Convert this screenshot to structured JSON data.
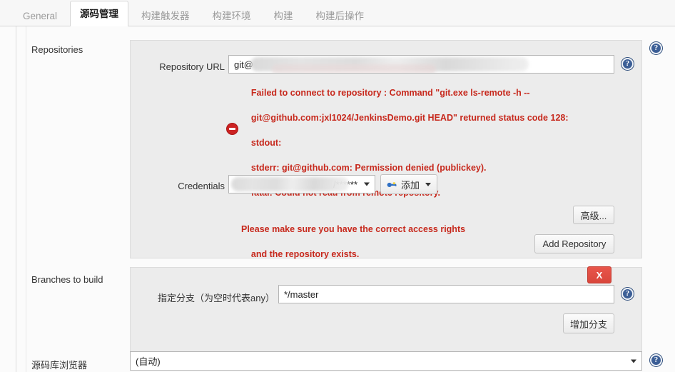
{
  "tabs": [
    {
      "label": "General",
      "active": false
    },
    {
      "label": "源码管理",
      "active": true
    },
    {
      "label": "构建触发器",
      "active": false
    },
    {
      "label": "构建环境",
      "active": false
    },
    {
      "label": "构建",
      "active": false
    },
    {
      "label": "构建后操作",
      "active": false
    }
  ],
  "sections": {
    "repositories": {
      "label": "Repositories",
      "repository_url": {
        "label": "Repository URL",
        "value": "git@",
        "redacted": true
      },
      "error": {
        "icon": "error-stop-icon",
        "line1": "Failed to connect to repository : Command \"git.exe ls-remote -h --",
        "line2": "git@github.com:jxl1024/JenkinsDemo.git HEAD\" returned status code 128:",
        "line3": "stdout:",
        "line4": "stderr: git@github.com: Permission denied (publickey).",
        "line5": "fatal: Could not read from remote repository.",
        "line6": "Please make sure you have the correct access rights",
        "line7": "and the repository exists."
      },
      "credentials": {
        "label": "Credentials",
        "value": "/******",
        "redacted": true,
        "add_button": "添加",
        "add_button_icon": "key-icon"
      },
      "advanced_button": "高级...",
      "add_repository_button": "Add Repository"
    },
    "branches": {
      "label": "Branches to build",
      "delete_button": "X",
      "branch_specifier": {
        "label": "指定分支（为空时代表any）",
        "value": "*/master"
      },
      "add_branch_button": "增加分支"
    },
    "repository_browser": {
      "label": "源码库浏览器",
      "value": "(自动)"
    }
  },
  "icons": {
    "help": "?"
  },
  "colors": {
    "error_red": "#c7291d",
    "danger_button": "#d9463b",
    "help_blue": "#3b5e96",
    "panel_bg": "#ececec"
  }
}
